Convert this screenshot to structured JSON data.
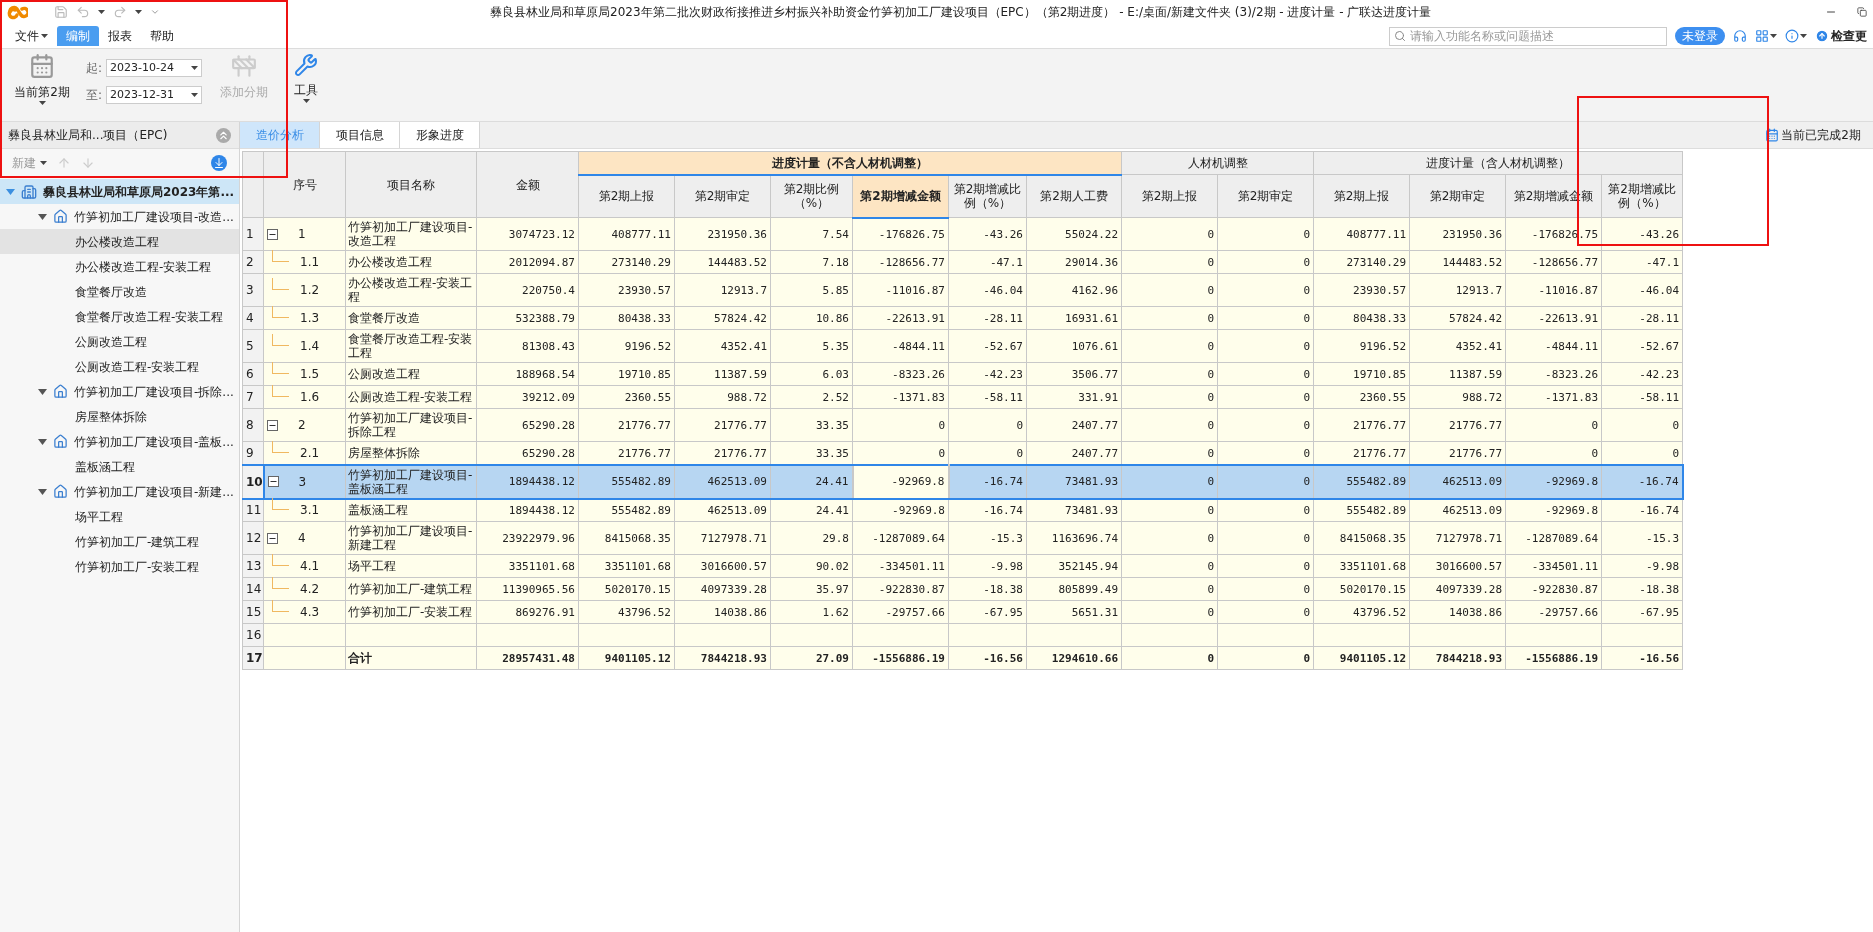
{
  "window": {
    "title": "彝良县林业局和草原局2023年第二批次财政衔接推进乡村振兴补助资金竹笋初加工厂建设项目（EPC）（第2期进度） - E:/桌面/新建文件夹 (3)/2期 - 进度计量 - 广联达进度计量"
  },
  "menu": [
    {
      "label": "文件",
      "selected": false,
      "dropdown": true
    },
    {
      "label": "编制",
      "selected": true,
      "dropdown": false
    },
    {
      "label": "报表",
      "selected": false,
      "dropdown": false
    },
    {
      "label": "帮助",
      "selected": false,
      "dropdown": false
    }
  ],
  "search": {
    "placeholder": "请输入功能名称或问题描述"
  },
  "login_button": "未登录",
  "update_button": "检查更",
  "ribbon": {
    "period_button": "当前第2期",
    "start_label": "起:",
    "start_date": "2023-10-24",
    "end_label": "至:",
    "end_date": "2023-12-31",
    "add_period": {
      "label": "添加分期",
      "disabled": true
    },
    "tools_button": "工具"
  },
  "sidebar": {
    "title": "彝良县林业局和...项目（EPC)",
    "new_button": {
      "label": "新建",
      "disabled": true
    },
    "tree": [
      {
        "label": "彝良县林业局和草原局2023年第...",
        "selected": true,
        "hovered": false,
        "expanded": true,
        "children": [
          {
            "label": "竹笋初加工厂建设项目-改造...",
            "selected": false,
            "hovered": false,
            "expanded": true,
            "children": [
              {
                "label": "办公楼改造工程",
                "selected": false,
                "hovered": true
              },
              {
                "label": "办公楼改造工程-安装工程",
                "selected": false,
                "hovered": false
              },
              {
                "label": "食堂餐厅改造",
                "selected": false,
                "hovered": false
              },
              {
                "label": "食堂餐厅改造工程-安装工程",
                "selected": false,
                "hovered": false
              },
              {
                "label": "公厕改造工程",
                "selected": false,
                "hovered": false
              },
              {
                "label": "公厕改造工程-安装工程",
                "selected": false,
                "hovered": false
              }
            ]
          },
          {
            "label": "竹笋初加工厂建设项目-拆除...",
            "selected": false,
            "hovered": false,
            "expanded": true,
            "children": [
              {
                "label": "房屋整体拆除",
                "selected": false,
                "hovered": false
              }
            ]
          },
          {
            "label": "竹笋初加工厂建设项目-盖板...",
            "selected": false,
            "hovered": false,
            "expanded": true,
            "children": [
              {
                "label": "盖板涵工程",
                "selected": false,
                "hovered": false
              }
            ]
          },
          {
            "label": "竹笋初加工厂建设项目-新建...",
            "selected": false,
            "hovered": false,
            "expanded": true,
            "children": [
              {
                "label": "场平工程",
                "selected": false,
                "hovered": false
              },
              {
                "label": "竹笋初加工厂-建筑工程",
                "selected": false,
                "hovered": false
              },
              {
                "label": "竹笋初加工厂-安装工程",
                "selected": false,
                "hovered": false
              }
            ]
          }
        ]
      }
    ]
  },
  "tabs": [
    {
      "label": "造价分析",
      "selected": true
    },
    {
      "label": "项目信息",
      "selected": false
    },
    {
      "label": "形象进度",
      "selected": false
    }
  ],
  "progress_note": "当前已完成2期",
  "table": {
    "columns": [
      {
        "label": "序号"
      },
      {
        "label": "项目名称"
      },
      {
        "label": "金额"
      }
    ],
    "groups": [
      {
        "label": "进度计量（不含人材机调整）",
        "columns": [
          {
            "label": "第2期上报",
            "selected": false
          },
          {
            "label": "第2期审定",
            "selected": false
          },
          {
            "label": "第2期比例（%）",
            "selected": false
          },
          {
            "label": "第2期增减金额",
            "selected": true
          },
          {
            "label": "第2期增减比例（%）",
            "selected": false
          },
          {
            "label": "第2期人工费",
            "selected": false
          }
        ]
      },
      {
        "label": "人材机调整",
        "columns": [
          {
            "label": "第2期上报",
            "selected": false
          },
          {
            "label": "第2期审定",
            "selected": false
          }
        ]
      },
      {
        "label": "进度计量（含人材机调整）",
        "columns": [
          {
            "label": "第2期上报",
            "selected": false
          },
          {
            "label": "第2期审定",
            "selected": false
          },
          {
            "label": "第2期增减金额",
            "selected": false
          },
          {
            "label": "第2期增减比例（%）",
            "selected": false
          }
        ]
      }
    ],
    "rows": [
      {
        "number": "1",
        "kind": "group",
        "expanded": true,
        "selected": false,
        "seq": "1",
        "name": "竹笋初加工厂建设项目-改造工程",
        "values": [
          "3074723.12",
          "408777.11",
          "231950.36",
          "7.54",
          "-176826.75",
          "-43.26",
          "55024.22",
          "0",
          "0",
          "408777.11",
          "231950.36",
          "-176826.75",
          "-43.26"
        ]
      },
      {
        "number": "2",
        "kind": "item",
        "selected": false,
        "seq": "1.1",
        "name": "办公楼改造工程",
        "values": [
          "2012094.87",
          "273140.29",
          "144483.52",
          "7.18",
          "-128656.77",
          "-47.1",
          "29014.36",
          "0",
          "0",
          "273140.29",
          "144483.52",
          "-128656.77",
          "-47.1"
        ]
      },
      {
        "number": "3",
        "kind": "item",
        "selected": false,
        "seq": "1.2",
        "name": "办公楼改造工程-安装工程",
        "values": [
          "220750.4",
          "23930.57",
          "12913.7",
          "5.85",
          "-11016.87",
          "-46.04",
          "4162.96",
          "0",
          "0",
          "23930.57",
          "12913.7",
          "-11016.87",
          "-46.04"
        ]
      },
      {
        "number": "4",
        "kind": "item",
        "selected": false,
        "seq": "1.3",
        "name": "食堂餐厅改造",
        "values": [
          "532388.79",
          "80438.33",
          "57824.42",
          "10.86",
          "-22613.91",
          "-28.11",
          "16931.61",
          "0",
          "0",
          "80438.33",
          "57824.42",
          "-22613.91",
          "-28.11"
        ]
      },
      {
        "number": "5",
        "kind": "item",
        "selected": false,
        "seq": "1.4",
        "name": "食堂餐厅改造工程-安装工程",
        "values": [
          "81308.43",
          "9196.52",
          "4352.41",
          "5.35",
          "-4844.11",
          "-52.67",
          "1076.61",
          "0",
          "0",
          "9196.52",
          "4352.41",
          "-4844.11",
          "-52.67"
        ]
      },
      {
        "number": "6",
        "kind": "item",
        "selected": false,
        "seq": "1.5",
        "name": "公厕改造工程",
        "values": [
          "188968.54",
          "19710.85",
          "11387.59",
          "6.03",
          "-8323.26",
          "-42.23",
          "3506.77",
          "0",
          "0",
          "19710.85",
          "11387.59",
          "-8323.26",
          "-42.23"
        ]
      },
      {
        "number": "7",
        "kind": "item",
        "selected": false,
        "seq": "1.6",
        "name": "公厕改造工程-安装工程",
        "values": [
          "39212.09",
          "2360.55",
          "988.72",
          "2.52",
          "-1371.83",
          "-58.11",
          "331.91",
          "0",
          "0",
          "2360.55",
          "988.72",
          "-1371.83",
          "-58.11"
        ]
      },
      {
        "number": "8",
        "kind": "group",
        "expanded": true,
        "selected": false,
        "seq": "2",
        "name": "竹笋初加工厂建设项目-拆除工程",
        "values": [
          "65290.28",
          "21776.77",
          "21776.77",
          "33.35",
          "0",
          "0",
          "2407.77",
          "0",
          "0",
          "21776.77",
          "21776.77",
          "0",
          "0"
        ]
      },
      {
        "number": "9",
        "kind": "item",
        "selected": false,
        "seq": "2.1",
        "name": "房屋整体拆除",
        "values": [
          "65290.28",
          "21776.77",
          "21776.77",
          "33.35",
          "0",
          "0",
          "2407.77",
          "0",
          "0",
          "21776.77",
          "21776.77",
          "0",
          "0"
        ]
      },
      {
        "number": "10",
        "kind": "group",
        "expanded": true,
        "selected": true,
        "seq": "3",
        "name": "竹笋初加工厂建设项目-盖板涵工程",
        "values": [
          "1894438.12",
          "555482.89",
          "462513.09",
          "24.41",
          "-92969.8",
          "-16.74",
          "73481.93",
          "0",
          "0",
          "555482.89",
          "462513.09",
          "-92969.8",
          "-16.74"
        ]
      },
      {
        "number": "11",
        "kind": "item",
        "selected": false,
        "seq": "3.1",
        "name": "盖板涵工程",
        "values": [
          "1894438.12",
          "555482.89",
          "462513.09",
          "24.41",
          "-92969.8",
          "-16.74",
          "73481.93",
          "0",
          "0",
          "555482.89",
          "462513.09",
          "-92969.8",
          "-16.74"
        ]
      },
      {
        "number": "12",
        "kind": "group",
        "expanded": true,
        "selected": false,
        "seq": "4",
        "name": "竹笋初加工厂建设项目-新建工程",
        "values": [
          "23922979.96",
          "8415068.35",
          "7127978.71",
          "29.8",
          "-1287089.64",
          "-15.3",
          "1163696.74",
          "0",
          "0",
          "8415068.35",
          "7127978.71",
          "-1287089.64",
          "-15.3"
        ]
      },
      {
        "number": "13",
        "kind": "item",
        "selected": false,
        "seq": "4.1",
        "name": "场平工程",
        "values": [
          "3351101.68",
          "3351101.68",
          "3016600.57",
          "90.02",
          "-334501.11",
          "-9.98",
          "352145.94",
          "0",
          "0",
          "3351101.68",
          "3016600.57",
          "-334501.11",
          "-9.98"
        ]
      },
      {
        "number": "14",
        "kind": "item",
        "selected": false,
        "seq": "4.2",
        "name": "竹笋初加工厂-建筑工程",
        "values": [
          "11390965.56",
          "5020170.15",
          "4097339.28",
          "35.97",
          "-922830.87",
          "-18.38",
          "805899.49",
          "0",
          "0",
          "5020170.15",
          "4097339.28",
          "-922830.87",
          "-18.38"
        ]
      },
      {
        "number": "15",
        "kind": "item",
        "selected": false,
        "seq": "4.3",
        "name": "竹笋初加工厂-安装工程",
        "values": [
          "869276.91",
          "43796.52",
          "14038.86",
          "1.62",
          "-29757.66",
          "-67.95",
          "5651.31",
          "0",
          "0",
          "43796.52",
          "14038.86",
          "-29757.66",
          "-67.95"
        ]
      },
      {
        "number": "16",
        "kind": "blank",
        "selected": false
      },
      {
        "number": "17",
        "kind": "total",
        "selected": false,
        "name": "合计",
        "values": [
          "28957431.48",
          "9401105.12",
          "7844218.93",
          "27.09",
          "-1556886.19",
          "-16.56",
          "1294610.66",
          "0",
          "0",
          "9401105.12",
          "7844218.93",
          "-1556886.19",
          "-16.56"
        ]
      }
    ]
  }
}
